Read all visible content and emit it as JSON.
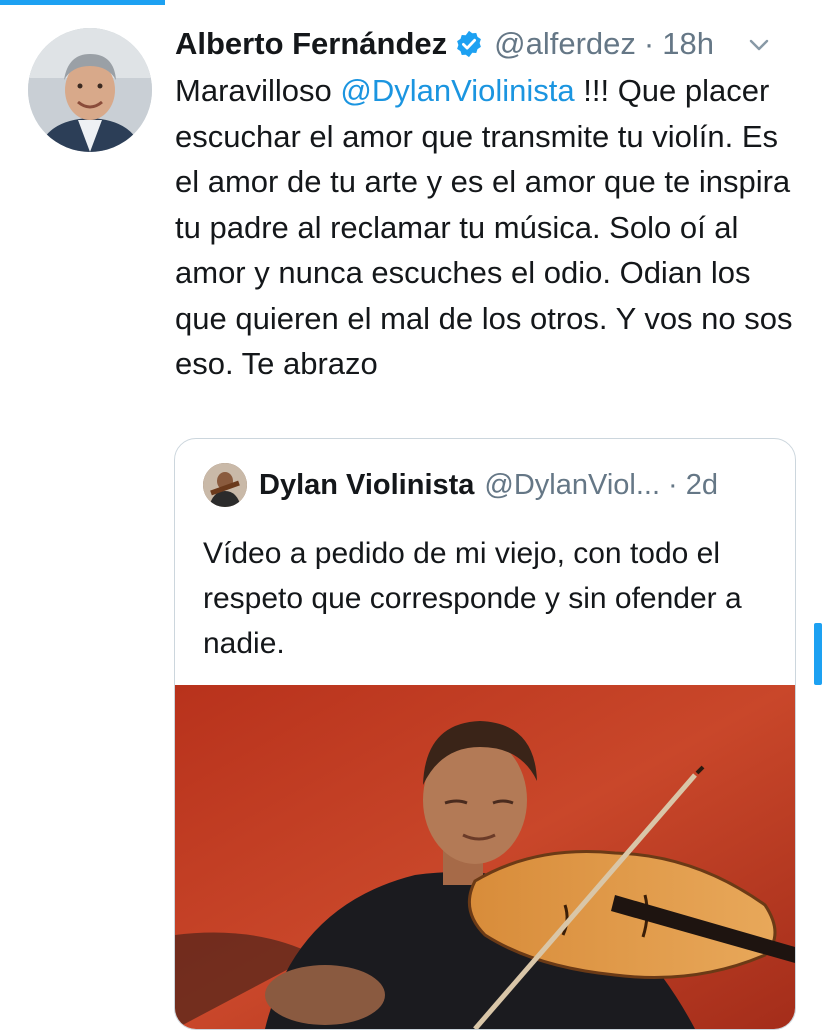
{
  "tweet": {
    "author_name": "Alberto Fernández",
    "handle": "@alferdez",
    "separator": "·",
    "time": "18h",
    "text_before": "Maravilloso ",
    "mention": "@DylanViolinista",
    "text_after": " !!! Que placer escuchar el amor que transmite tu violín. Es el amor de tu arte y es el amor que te inspira tu padre al reclamar tu música. Solo oí al amor y nunca escuches el odio. Odian los que quieren el mal de los otros. Y vos no sos eso. Te abrazo"
  },
  "quoted": {
    "author_name": "Dylan Violinista",
    "handle": "@DylanViol...",
    "separator": "·",
    "time": "2d",
    "text": "Vídeo a pedido de mi viejo, con todo el respeto que corresponde y sin ofender a nadie."
  },
  "icons": {
    "verified": "verified-badge-icon",
    "more": "chevron-down-icon"
  },
  "colors": {
    "accent": "#1da1f2",
    "mention": "#1b95e0",
    "secondary_text": "#657786",
    "primary_text": "#14171a",
    "card_border": "#ccd6dd"
  }
}
